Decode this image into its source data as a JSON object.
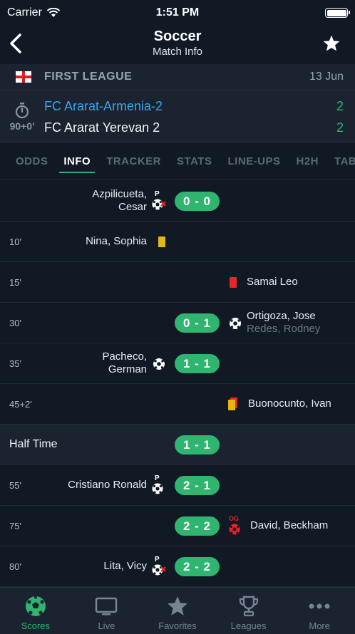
{
  "status": {
    "carrier": "Carrier",
    "time": "1:51 PM"
  },
  "nav": {
    "title": "Soccer",
    "subtitle": "Match Info"
  },
  "league": {
    "name": "FIRST LEAGUE",
    "date": "13 Jun",
    "flag": "england-flag"
  },
  "match": {
    "clock": "90+0'",
    "home": {
      "name": "FC Ararat-Armenia-2",
      "score": "2"
    },
    "away": {
      "name": "FC Ararat Yerevan 2",
      "score": "2"
    }
  },
  "tabs": [
    "ODDS",
    "INFO",
    "TRACKER",
    "STATS",
    "LINE-UPS",
    "H2H",
    "TABLE"
  ],
  "active_tab": "INFO",
  "events": [
    {
      "minute": "",
      "left_line1": "Azpilicueta,",
      "left_line2": "Cesar",
      "left_icon": "penalty-missed-icon",
      "score": "0 - 0"
    },
    {
      "minute": "10'",
      "left_line1": "Nina, Sophia",
      "left_icon": "yellow-card-icon"
    },
    {
      "minute": "15'",
      "right_line1": "Samai Leo",
      "right_icon": "red-card-icon"
    },
    {
      "minute": "30'",
      "score": "0 - 1",
      "right_icon": "goal-icon",
      "right_line1": "Ortigoza, Jose",
      "right_assist": "Redes, Rodney"
    },
    {
      "minute": "35'",
      "left_line1": "Pacheco,",
      "left_line2": "German",
      "left_icon": "goal-icon",
      "score": "1 - 1"
    },
    {
      "minute": "45+2'",
      "right_icon": "second-yellow-card-icon",
      "right_line1": "Buonocunto, Ivan"
    },
    {
      "half_time": "Half Time",
      "score": "1 - 1"
    },
    {
      "minute": "55'",
      "left_line1": "Cristiano Ronald",
      "left_icon": "penalty-goal-icon",
      "score": "2 - 1"
    },
    {
      "minute": "75'",
      "score": "2 - 2",
      "right_icon": "own-goal-icon",
      "right_line1": "David, Beckham"
    },
    {
      "minute": "80'",
      "left_line1": "Lita, Vicy",
      "left_icon": "penalty-missed-icon",
      "score": "2 - 2"
    }
  ],
  "tabbar": [
    {
      "label": "Scores",
      "icon": "soccer-ball-icon",
      "active": true
    },
    {
      "label": "Live",
      "icon": "tv-icon",
      "active": false
    },
    {
      "label": "Favorites",
      "icon": "star-icon",
      "active": false
    },
    {
      "label": "Leagues",
      "icon": "trophy-icon",
      "active": false
    },
    {
      "label": "More",
      "icon": "more-dots-icon",
      "active": false
    }
  ],
  "colors": {
    "accent": "#2fb56f",
    "home_team": "#3aa4e8",
    "yellow_card": "#e3b90f",
    "red_card": "#e8262a",
    "background": "#111925",
    "panel": "#1b2331"
  },
  "icon_labels": {
    "penalty": "P",
    "own_goal": "OG"
  }
}
